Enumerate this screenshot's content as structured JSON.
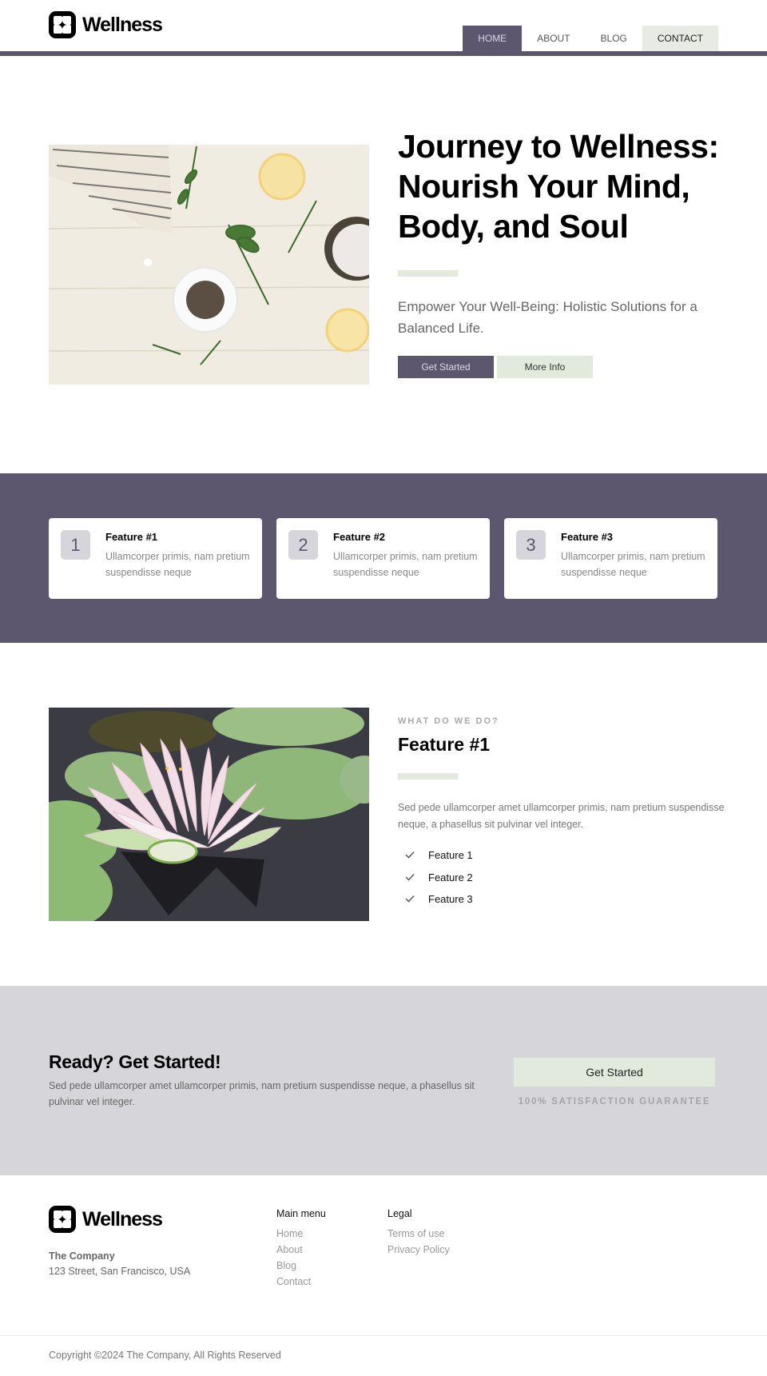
{
  "header": {
    "logo_text": "Wellness",
    "nav": [
      {
        "label": "HOME",
        "active": true
      },
      {
        "label": "ABOUT",
        "active": false
      },
      {
        "label": "BLOG",
        "active": false
      },
      {
        "label": "CONTACT",
        "active": false
      }
    ]
  },
  "hero": {
    "image_alt": "Herbs, lemons, salt and spices on a white wooden table",
    "title": "Journey to Wellness: Nourish Your Mind, Body, and Soul",
    "subtitle": "Empower Your Well-Being: Holistic Solutions for a Balanced Life.",
    "primary_button": "Get Started",
    "secondary_button": "More Info"
  },
  "features": [
    {
      "number": "1",
      "title": "Feature #1",
      "text": "Ullamcorper primis, nam pretium suspendisse neque"
    },
    {
      "number": "2",
      "title": "Feature #2",
      "text": "Ullamcorper primis, nam pretium suspendisse neque"
    },
    {
      "number": "3",
      "title": "Feature #3",
      "text": "Ullamcorper primis, nam pretium suspendisse neque"
    }
  ],
  "detail": {
    "image_alt": "Pink water lily among lily pads",
    "eyebrow": "WHAT DO WE DO?",
    "title": "Feature #1",
    "paragraph": "Sed pede ullamcorper amet ullamcorper primis, nam pretium suspendisse neque, a phasellus sit pulvinar vel integer.",
    "checklist": [
      "Feature 1",
      "Feature 2",
      "Feature 3"
    ]
  },
  "cta": {
    "title": "Ready? Get Started!",
    "text": "Sed pede ullamcorper amet ullamcorper primis, nam pretium suspendisse neque, a phasellus sit pulvinar vel integer.",
    "button": "Get Started",
    "note": "100% SATISFACTION GUARANTEE"
  },
  "footer": {
    "logo_text": "Wellness",
    "company": "The Company",
    "address": "123 Street, San Francisco, USA",
    "main_menu": {
      "heading": "Main menu",
      "links": [
        "Home",
        "About",
        "Blog",
        "Contact"
      ]
    },
    "legal": {
      "heading": "Legal",
      "links": [
        "Terms of use",
        "Privacy Policy"
      ]
    },
    "copyright": "Copyright ©2024 The Company, All Rights Reserved"
  },
  "colors": {
    "brand_purple": "#5c576e",
    "accent_green": "#e2e9dd",
    "cta_gray": "#d6d5da"
  }
}
